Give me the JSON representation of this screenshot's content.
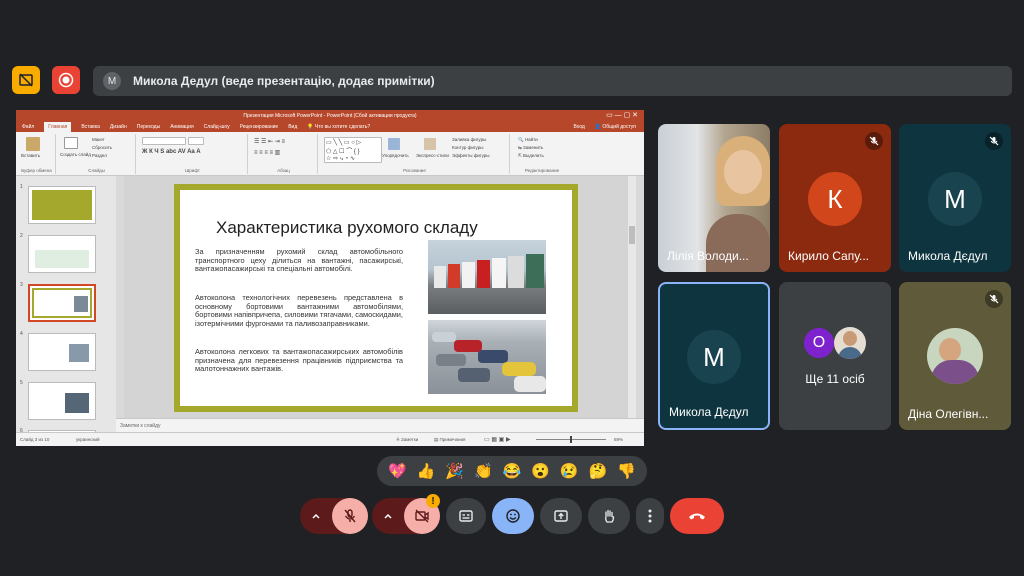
{
  "banner": {
    "avatar_letter": "M",
    "text": "Микола Дедул (веде презентацію, додає примітки)"
  },
  "ppt": {
    "window_title": "Презентация Microsoft PowerPoint - PowerPoint (Сбой активации продукта)",
    "tabs": [
      "Файл",
      "Главная",
      "Вставка",
      "Дизайн",
      "Переходы",
      "Анимация",
      "Слайд-шоу",
      "Рецензирование",
      "Вид"
    ],
    "active_tab": "Главная",
    "tell_me": "Что вы хотите сделать?",
    "signin": "Вход",
    "share": "Общий доступ",
    "ribbon": {
      "paste": "Вставить",
      "clipboard": "Буфер обмена",
      "new_slide": "Создать слайд",
      "layout": "Макет",
      "reset": "Сбросить",
      "section": "Раздел",
      "slides": "Слайды",
      "font": "Шрифт",
      "paragraph": "Абзац",
      "arrange": "Упорядочить",
      "quick_styles": "Экспресс-стили",
      "fill": "Заливка фигуры",
      "outline": "Контур фигуры",
      "effects": "Эффекты фигуры",
      "drawing": "Рисование",
      "find": "Найти",
      "replace": "Заменить",
      "select": "Выделить",
      "editing": "Редактирование"
    },
    "thumb_numbers": [
      "1",
      "2",
      "3",
      "4",
      "5",
      "6"
    ],
    "slide": {
      "title": "Характеристика рухомого складу",
      "paragraphs": [
        "За призначенням рухомий склад автомобільного транспортного цеху ділиться на вантажні, пасажирські, вантажопасажирські та спеціальні автомобілі.",
        "Автоколона технологічних перевезень представлена в основному бортовими вантажними автомобілями, бортовими напівпричепа, силовими тягачами, самоскидами, ізотермічними фургонами та паливозаправниками.",
        "Автоколона легкових та вантажопасажирських автомобілів призначена для перевезення працівників підприємства та малотоннажних вантажів."
      ]
    },
    "notes_placeholder": "Заметки к слайду",
    "status": {
      "slide_counter": "Слайд 3 из 10",
      "language": "украинский",
      "notes": "Заметки",
      "comments": "Примечания",
      "zoom": "69%"
    }
  },
  "participants": [
    {
      "name": "Лілія Володи...",
      "type": "video",
      "muted": false
    },
    {
      "name": "Кирило Сапу...",
      "letter": "К",
      "avatar_color": "#d2461c",
      "muted": true
    },
    {
      "name": "Микола Дєдул",
      "letter": "М",
      "avatar_color": "#1a4350",
      "muted": true
    },
    {
      "name": "Микола Дєдул",
      "letter": "М",
      "avatar_color": "#1a4350",
      "muted": false,
      "speaking": true
    },
    {
      "name": "Ще 11 осіб",
      "letter": "О",
      "avatar_color": "#7e22ce"
    },
    {
      "name": "Діна Олегівн...",
      "type": "photo",
      "muted": true
    }
  ],
  "reactions": [
    "💖",
    "👍",
    "🎉",
    "👏",
    "😂",
    "😮",
    "😢",
    "🤔",
    "👎"
  ],
  "colors": {
    "background": "#202124",
    "accent": "#8ab4f8",
    "danger": "#ea4335",
    "ppt_red": "#b7472a"
  }
}
